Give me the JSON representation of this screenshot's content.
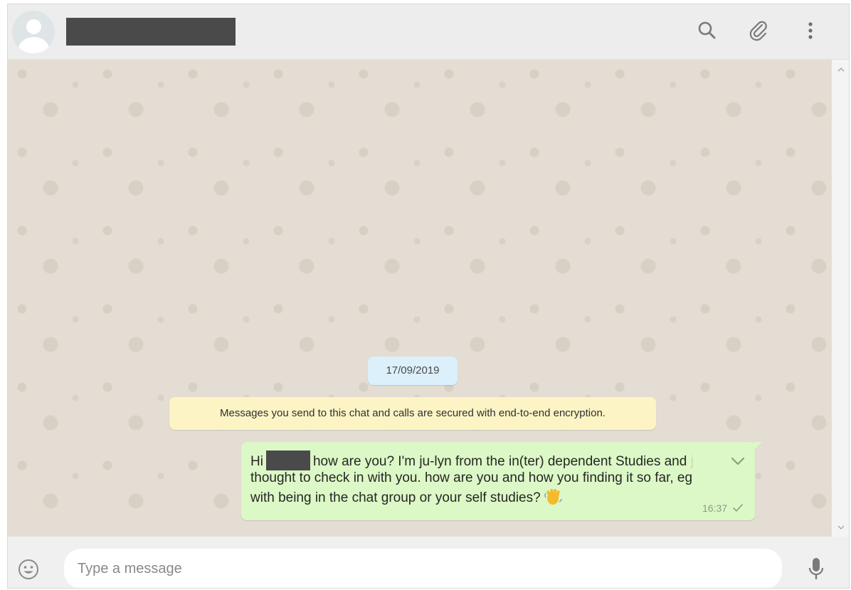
{
  "header": {
    "contact_name_redacted": true,
    "icons": [
      "search-icon",
      "attach-icon",
      "menu-icon"
    ]
  },
  "chat": {
    "date_label": "17/09/2019",
    "encryption_notice": "Messages you send to this chat and calls are secured with end-to-end encryption.",
    "message": {
      "line1_start": "Hi",
      "line1_end": "how are you? I'm ju-lyn from the in(ter) dependent Studies and ",
      "line1_fade": "j",
      "line2": "thought to check in with you. how are you and how you finding it so far, eg",
      "line3": "with being in the chat group or your self studies?",
      "emoji": "waving-hand",
      "time": "16:37",
      "status": "sent"
    }
  },
  "footer": {
    "placeholder": "Type a message",
    "icons": [
      "emoji-icon",
      "microphone-icon"
    ]
  },
  "colors": {
    "header_bg": "#ededed",
    "chat_bg": "#e3ddd3",
    "outgoing_bubble": "#dcf8c6",
    "date_pill": "#dcf0fb",
    "notice": "#fdf4c5"
  }
}
